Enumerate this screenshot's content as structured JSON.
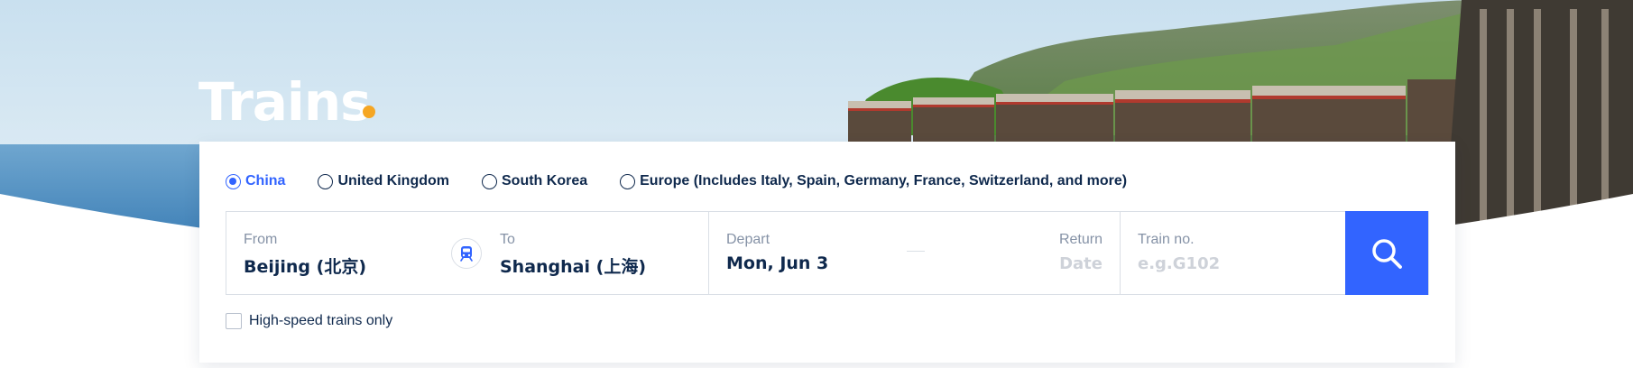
{
  "page": {
    "title": "Trains",
    "accent_color": "#3264ff",
    "dot_color": "#f5a623"
  },
  "regions": [
    {
      "label": "China",
      "selected": true
    },
    {
      "label": "United Kingdom",
      "selected": false
    },
    {
      "label": "South Korea",
      "selected": false
    },
    {
      "label": "Europe (Includes Italy, Spain, Germany, France, Switzerland, and more)",
      "selected": false
    }
  ],
  "search": {
    "from_label": "From",
    "from_value": "Beijing (北京)",
    "swap_icon": "train-icon",
    "to_label": "To",
    "to_value": "Shanghai (上海)",
    "depart_label": "Depart",
    "depart_value": "Mon, Jun 3",
    "return_label": "Return",
    "return_placeholder": "Date",
    "train_no_label": "Train no.",
    "train_no_placeholder": "e.g.G102",
    "search_icon": "search-icon"
  },
  "options": {
    "high_speed_label": "High-speed trains only",
    "high_speed_checked": false
  }
}
